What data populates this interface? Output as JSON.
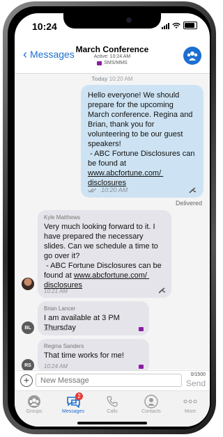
{
  "status": {
    "time": "10:24"
  },
  "header": {
    "back_label": "Messages",
    "title": "March Conference",
    "subtitle": "Active: 10:24 AM",
    "type": "SMS/MMS"
  },
  "messages": {
    "date_sep_day": "Today",
    "date_sep_time": "10:20 AM",
    "outgoing": {
      "text_main": "Hello everyone! We should prepare for the upcoming March conference. Regina and Brian, thank you for volunteering to be our guest speakers!\n - ABC Fortune Disclosures can be found at ",
      "link": "www.abcfortune.com/ disclosures",
      "time": "10:20 AM",
      "delivered": "Delivered"
    },
    "incoming": [
      {
        "sender": "Kyle Matthews",
        "text_main": "Very much looking forward to it. I have prepared the necessary slides. Can we schedule a time to go over it?\n - ABC Fortune Disclosures can be found at ",
        "link": "www.abcfortune.com/ disclosures",
        "time": "10:21 AM"
      },
      {
        "sender": "Brian Lancer",
        "initials": "BL",
        "text": "I am available at 3 PM Thursday",
        "time": "10:21 AM"
      },
      {
        "sender": "Regina Sanders",
        "initials": "RS",
        "text": "That time works for me!",
        "time": "10:24 AM"
      }
    ]
  },
  "composer": {
    "placeholder": "New Message",
    "counter": "0/1500",
    "send_label": "Send"
  },
  "tabs": [
    {
      "label": "Groups"
    },
    {
      "label": "Messages",
      "badge": "2"
    },
    {
      "label": "Calls"
    },
    {
      "label": "Contacts"
    },
    {
      "label": "More"
    }
  ],
  "colors": {
    "accent": "#1c6fd0",
    "outgoing_bubble": "#cde3f3",
    "incoming_bubble": "#e4e4ea",
    "badge": "#e53935"
  }
}
